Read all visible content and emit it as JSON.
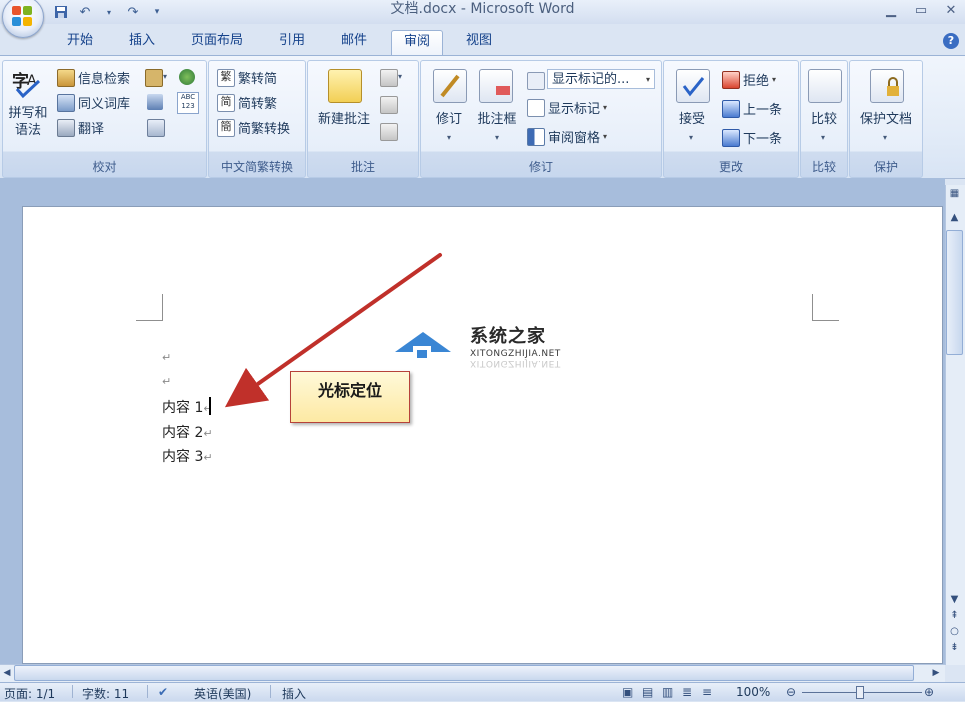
{
  "title_bar": {
    "title": "文档.docx - Microsoft Word"
  },
  "tabs": [
    {
      "label": "开始"
    },
    {
      "label": "插入"
    },
    {
      "label": "页面布局"
    },
    {
      "label": "引用"
    },
    {
      "label": "邮件"
    },
    {
      "label": "审阅",
      "active": true
    },
    {
      "label": "视图"
    }
  ],
  "ribbon": {
    "proofing": {
      "label": "校对",
      "spelling": [
        "拼写和",
        "语法"
      ],
      "research": "信息检索",
      "thesaurus": "同义词库",
      "translate": "翻译",
      "wordcount_badge": "ABC\n123"
    },
    "chinese_conv": {
      "label": "中文简繁转换",
      "to_simplified": "繁转简",
      "to_traditional": "简转繁",
      "conversion": "简繁转换"
    },
    "comments": {
      "label": "批注",
      "new_comment": "新建批注"
    },
    "tracking": {
      "label": "修订",
      "track_changes": "修订",
      "balloons": "批注框",
      "display_select": "显示标记的...",
      "show_markup": "显示标记",
      "reviewing_pane": "审阅窗格"
    },
    "changes": {
      "label": "更改",
      "accept": "接受",
      "reject": "拒绝",
      "previous": "上一条",
      "next": "下一条"
    },
    "compare": {
      "label": "比较",
      "compare": "比较"
    },
    "protect": {
      "label": "保护",
      "protect_doc": "保护文档"
    }
  },
  "document": {
    "lines": [
      "内容 1",
      "内容 2",
      "内容 3"
    ],
    "callout": "光标定位"
  },
  "watermark": {
    "cn": "系统之家",
    "en": "XITONGZHIJIA.NET"
  },
  "status_bar": {
    "page": "页面: 1/1",
    "words": "字数: 11",
    "language": "英语(美国)",
    "mode": "插入",
    "zoom": "100%"
  },
  "colors": {
    "accent": "#15428b",
    "callout_border": "#b6423a",
    "arrow": "#c0302a"
  }
}
